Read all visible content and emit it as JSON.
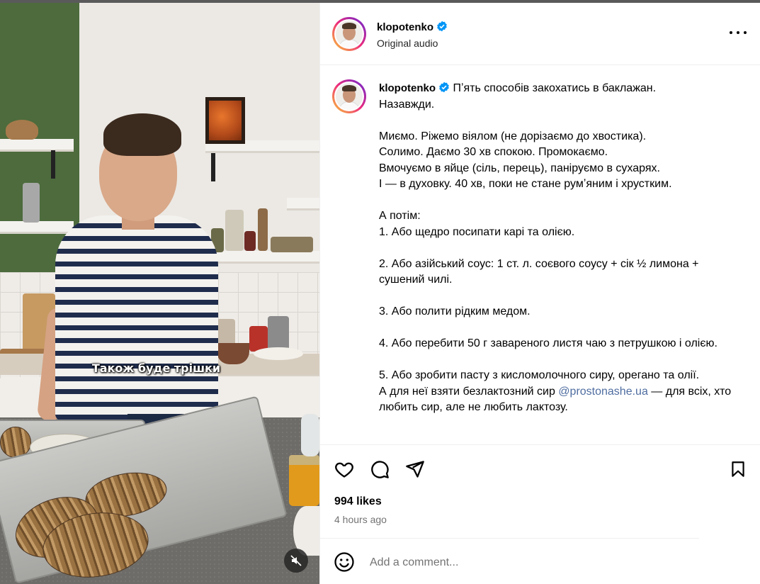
{
  "media": {
    "caption_overlay": "Також буде трішки",
    "mute_icon": "speaker-muted-icon"
  },
  "header": {
    "username": "klopotenko",
    "verified": true,
    "audio_label": "Original audio"
  },
  "post": {
    "username": "klopotenko",
    "caption_lines": [
      "Пʼять способів закохатись в баклажан.",
      "Назавжди.",
      "",
      "Миємо. Ріжемо віялом (не дорізаємо до хвостика).",
      "Солимо. Даємо 30 хв спокою. Промокаємо.",
      "Вмочуємо в яйце (сіль, перець), паніруємо в сухарях.",
      "І — в духовку. 40 хв, поки не стане румʼяним і хрусткиим."
    ],
    "caption_block_1": "Миємо. Ріжемо віялом (не дорізаємо до хвостика).\nСолимо. Даємо 30 хв спокою. Промокаємо.\nВмочуємо в яйце (сіль, перець), паніруємо в сухарях.\nІ — в духовку. 40 хв, поки не стане румʼяним і хрустким.",
    "caption_title_1": "Пʼять способів закохатись в баклажан.",
    "caption_title_2": "Назавжди.",
    "caption_then": "А потім:",
    "way_1": "1. Або щедро посипати карі та олією.",
    "way_2": "2. Або азійський соус: 1 ст. л. соєвого соусу + сік ½ лимона + сушений чилі.",
    "way_3": "3. Або полити рідким медом.",
    "way_4": "4. Або перебити 50 г завареного листя чаю з петрушкою і олією.",
    "way_5_a": "5. Або зробити пасту з кисломолочного сиру, орегано та олії.",
    "way_5_b": "А для неї взяти безлактозний сир ",
    "way_5_mention": "@prostonashe.ua",
    "way_5_c": " — для всіх, хто любить сир, але не любить лактозу."
  },
  "actions": {
    "like_icon": "heart-icon",
    "comment_icon": "comment-icon",
    "share_icon": "share-icon",
    "save_icon": "bookmark-icon",
    "likes": "994 likes",
    "time": "4 hours ago"
  },
  "comment": {
    "placeholder": "Add a comment...",
    "emoji_icon": "emoji-icon"
  },
  "colors": {
    "verified": "#0095f6",
    "mention": "#4f6da0",
    "muted_text": "#737373"
  }
}
